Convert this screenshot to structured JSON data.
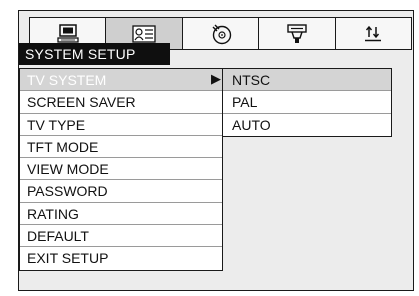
{
  "tabs": [
    {
      "icon": "monitor-icon",
      "active": false
    },
    {
      "icon": "language-card-icon",
      "active": true
    },
    {
      "icon": "disc-icon",
      "active": false
    },
    {
      "icon": "speaker-icon",
      "active": false
    },
    {
      "icon": "adjust-arrows-icon",
      "active": false
    }
  ],
  "menu": {
    "title": "SYSTEM SETUP",
    "items": [
      "TV SYSTEM",
      "SCREEN SAVER",
      "TV TYPE",
      "TFT MODE",
      "VIEW MODE",
      "PASSWORD",
      "RATING",
      "DEFAULT",
      "EXIT SETUP"
    ],
    "selected_index": 0
  },
  "pointer_glyph": "▶",
  "submenu": {
    "items": [
      "NTSC",
      "PAL",
      "AUTO"
    ],
    "selected_index": 0
  }
}
